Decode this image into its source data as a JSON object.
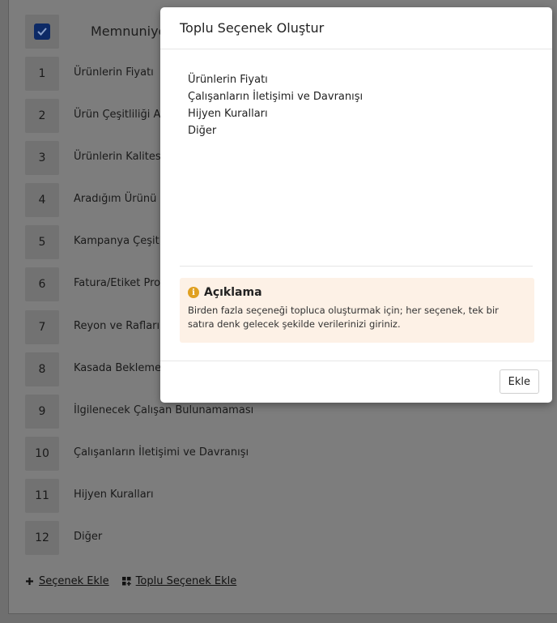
{
  "background": {
    "header_title": "Memnuniye",
    "rows": [
      {
        "num": "1",
        "label": "Ürünlerin Fiyatı"
      },
      {
        "num": "2",
        "label": "Ürün Çeşitliliği Az"
      },
      {
        "num": "3",
        "label": "Ürünlerin Kalitesi"
      },
      {
        "num": "4",
        "label": "Aradığım Ürünü B"
      },
      {
        "num": "5",
        "label": "Kampanya Çeşit"
      },
      {
        "num": "6",
        "label": "Fatura/Etiket Prob"
      },
      {
        "num": "7",
        "label": "Reyon ve Rafların"
      },
      {
        "num": "8",
        "label": "Kasada Bekleme"
      },
      {
        "num": "9",
        "label": "İlgilenecek Çalışan Bulunamaması"
      },
      {
        "num": "10",
        "label": "Çalışanların İletişimi ve Davranışı"
      },
      {
        "num": "11",
        "label": "Hijyen Kuralları"
      },
      {
        "num": "12",
        "label": "Diğer"
      }
    ],
    "footer": {
      "add_option": "Seçenek Ekle",
      "bulk_add_option": "Toplu Seçenek Ekle"
    }
  },
  "modal": {
    "title": "Toplu Seçenek Oluştur",
    "options": [
      "Ürünlerin Fiyatı",
      "Çalışanların İletişimi ve Davranışı",
      "Hijyen Kuralları",
      "Diğer"
    ],
    "info": {
      "title": "Açıklama",
      "text": "Birden fazla seçeneği topluca oluşturmak için; her seçenek, tek bir satıra denk gelecek şekilde verilerinizi giriniz."
    },
    "add_button": "Ekle"
  }
}
